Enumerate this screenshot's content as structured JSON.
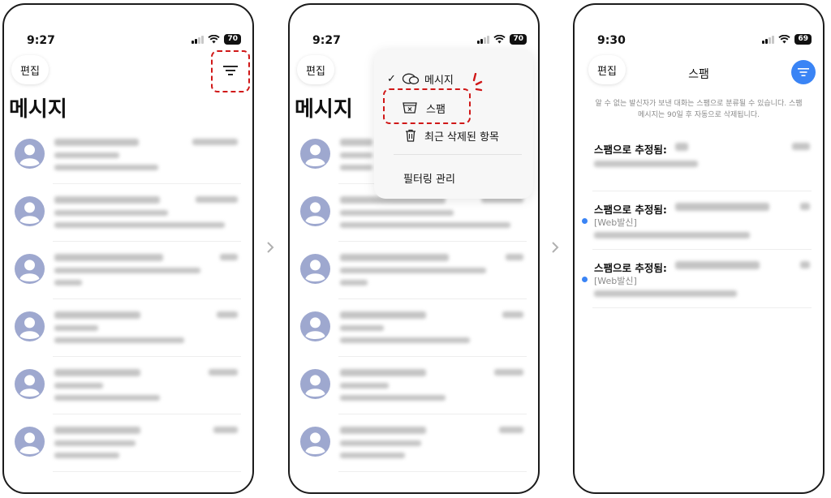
{
  "screens": [
    {
      "time": "9:27",
      "battery": "70",
      "edit_label": "편집",
      "title": "메시지",
      "rows": 6
    },
    {
      "time": "9:27",
      "battery": "70",
      "edit_label": "편집",
      "title": "메시지",
      "rows": 6,
      "menu": {
        "items": [
          {
            "label": "메시지",
            "icon": "chat-bubbles-icon",
            "checked": true
          },
          {
            "label": "스팸",
            "icon": "spam-tray-icon",
            "checked": false
          },
          {
            "label": "최근 삭제된 항목",
            "icon": "trash-icon",
            "checked": false
          },
          {
            "label": "필터링 관리",
            "icon": "",
            "checked": false
          }
        ],
        "check_glyph": "✓"
      }
    },
    {
      "time": "9:30",
      "battery": "69",
      "edit_label": "편집",
      "title": "스팸",
      "notice_line1": "알 수 없는 발신자가 보낸 대화는 스팸으로 분류될 수 있습니다. 스팸",
      "notice_line2": "메시지는 90일 후 자동으로 삭제됩니다.",
      "items": [
        {
          "label": "스팸으로 추정됨:",
          "tag": ""
        },
        {
          "label": "스팸으로 추정됨:",
          "tag": "[Web발신]"
        },
        {
          "label": "스팸으로 추정됨:",
          "tag": "[Web발신]"
        }
      ]
    }
  ],
  "colors": {
    "accent": "#3a84f5",
    "highlight_dash": "#d01818",
    "avatar": "#9ea8cf"
  }
}
